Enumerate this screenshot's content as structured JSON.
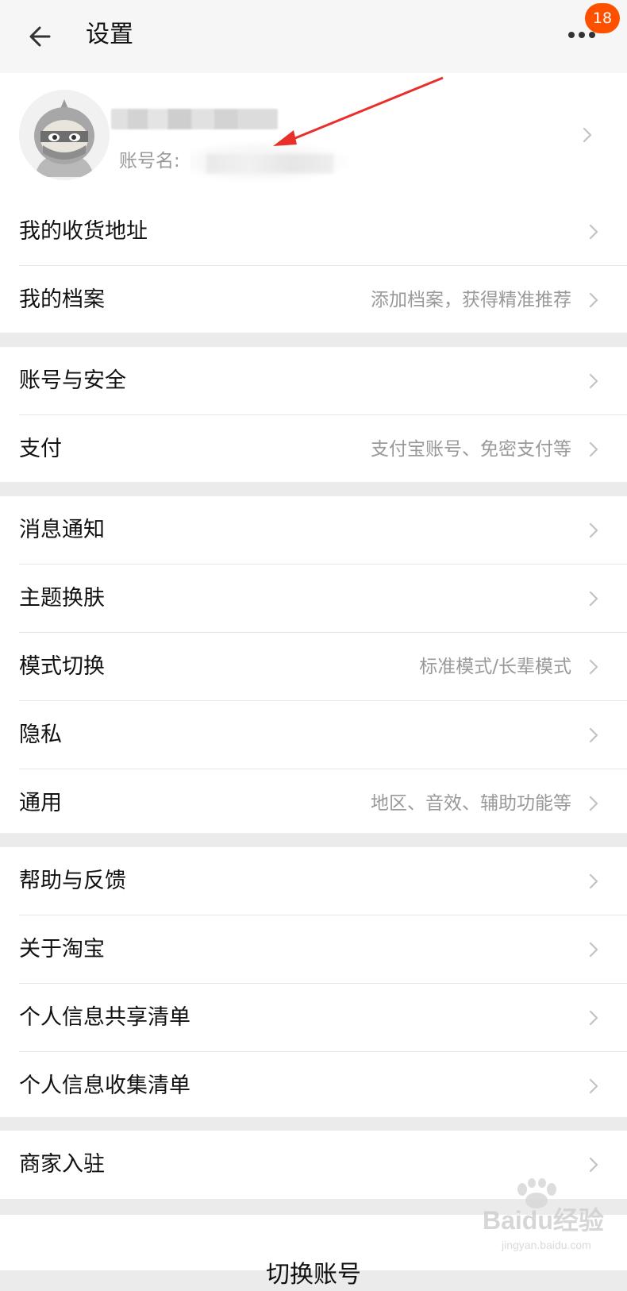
{
  "header": {
    "title": "设置",
    "badge_count": "18",
    "back_icon": "back-arrow-icon",
    "more_icon": "more-dots-icon"
  },
  "profile": {
    "account_prefix": "账号名:"
  },
  "sections": [
    [
      {
        "label": "我的收货地址",
        "hint": ""
      },
      {
        "label": "我的档案",
        "hint": "添加档案，获得精准推荐"
      }
    ],
    [
      {
        "label": "账号与安全",
        "hint": ""
      },
      {
        "label": "支付",
        "hint": "支付宝账号、免密支付等"
      }
    ],
    [
      {
        "label": "消息通知",
        "hint": ""
      },
      {
        "label": "主题换肤",
        "hint": ""
      },
      {
        "label": "模式切换",
        "hint": "标准模式/长辈模式"
      },
      {
        "label": "隐私",
        "hint": ""
      },
      {
        "label": "通用",
        "hint": "地区、音效、辅助功能等"
      }
    ],
    [
      {
        "label": "帮助与反馈",
        "hint": ""
      },
      {
        "label": "关于淘宝",
        "hint": ""
      },
      {
        "label": "个人信息共享清单",
        "hint": ""
      },
      {
        "label": "个人信息收集清单",
        "hint": ""
      }
    ],
    [
      {
        "label": "商家入驻",
        "hint": ""
      }
    ]
  ],
  "bottom": {
    "switch_account": "切换账号"
  },
  "watermark": {
    "brand": "Baidu经验",
    "url": "jingyan.baidu.com"
  },
  "colors": {
    "accent": "#ff5000",
    "annotation_arrow": "#e8302a",
    "hint_text": "#999999",
    "page_bg": "#ebebeb"
  }
}
